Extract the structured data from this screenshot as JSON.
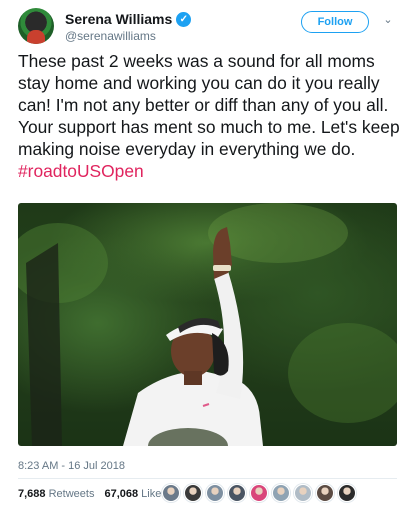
{
  "author": {
    "display_name": "Serena Williams",
    "handle": "@serenawilliams",
    "verified_icon": "verified-badge-icon"
  },
  "actions": {
    "follow_label": "Follow",
    "more_icon": "chevron-down-icon"
  },
  "tweet": {
    "text": "These past 2 weeks was a sound for all moms stay home and working you can do it you really can! I'm not any better or diff than any of you all. Your support has ment so much to me. Let's keep making noise everyday in everything we do.",
    "hashtag": "#roadtoUSOpen",
    "timestamp": "8:23 AM - 16 Jul 2018"
  },
  "engagement": {
    "retweets_count": "7,688",
    "retweets_label": "Retweets",
    "likes_count": "67,068",
    "likes_label": "Likes",
    "liker_avatar_colors": [
      "#6b7a8a",
      "#3a3a3a",
      "#7d8fa0",
      "#4a5563",
      "#d9467a",
      "#8fa3b3",
      "#b0bcc6",
      "#5b4b43",
      "#2b2b2b"
    ]
  },
  "colors": {
    "accent": "#1da1f2",
    "hashtag": "#e0245e",
    "secondary_text": "#657786"
  }
}
